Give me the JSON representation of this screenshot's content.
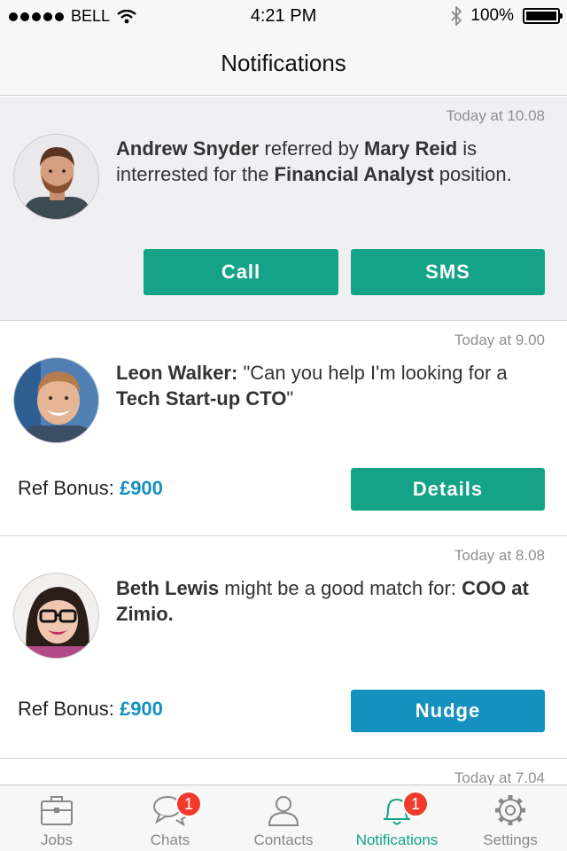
{
  "status": {
    "carrier": "BELL",
    "time": "4:21 PM",
    "battery": "100%"
  },
  "header": {
    "title": "Notifications"
  },
  "notifications": [
    {
      "time": "Today at 10.08",
      "name": "Andrew Snyder",
      "t1": " referred by ",
      "referrer": "Mary Reid",
      "t2": " is interrested for the ",
      "position": "Financial Analyst",
      "t3": " position.",
      "buttons": {
        "call": "Call",
        "sms": "SMS"
      }
    },
    {
      "time": "Today at 9.00",
      "name": "Leon Walker:",
      "t1": " \"Can you help I'm looking for a ",
      "role": "Tech Start-up CTO",
      "t2": "\"",
      "ref_label": "Ref Bonus: ",
      "ref_amount": "£900",
      "button": "Details"
    },
    {
      "time": "Today at 8.08",
      "name": "Beth Lewis",
      "t1": " might be a good match for: ",
      "role": "COO at Zimio.",
      "ref_label": "Ref Bonus: ",
      "ref_amount": "£900",
      "button": "Nudge"
    },
    {
      "time": "Today at 7.04"
    }
  ],
  "tabs": [
    {
      "label": "Jobs",
      "icon": "briefcase-icon"
    },
    {
      "label": "Chats",
      "icon": "chat-bubbles-icon",
      "badge": "1"
    },
    {
      "label": "Contacts",
      "icon": "person-icon"
    },
    {
      "label": "Notifications",
      "icon": "bell-icon",
      "badge": "1",
      "active": true
    },
    {
      "label": "Settings",
      "icon": "gear-icon"
    }
  ],
  "colors": {
    "accent_green": "#14a386",
    "accent_blue": "#1591c0",
    "badge_red": "#f03a2c"
  }
}
